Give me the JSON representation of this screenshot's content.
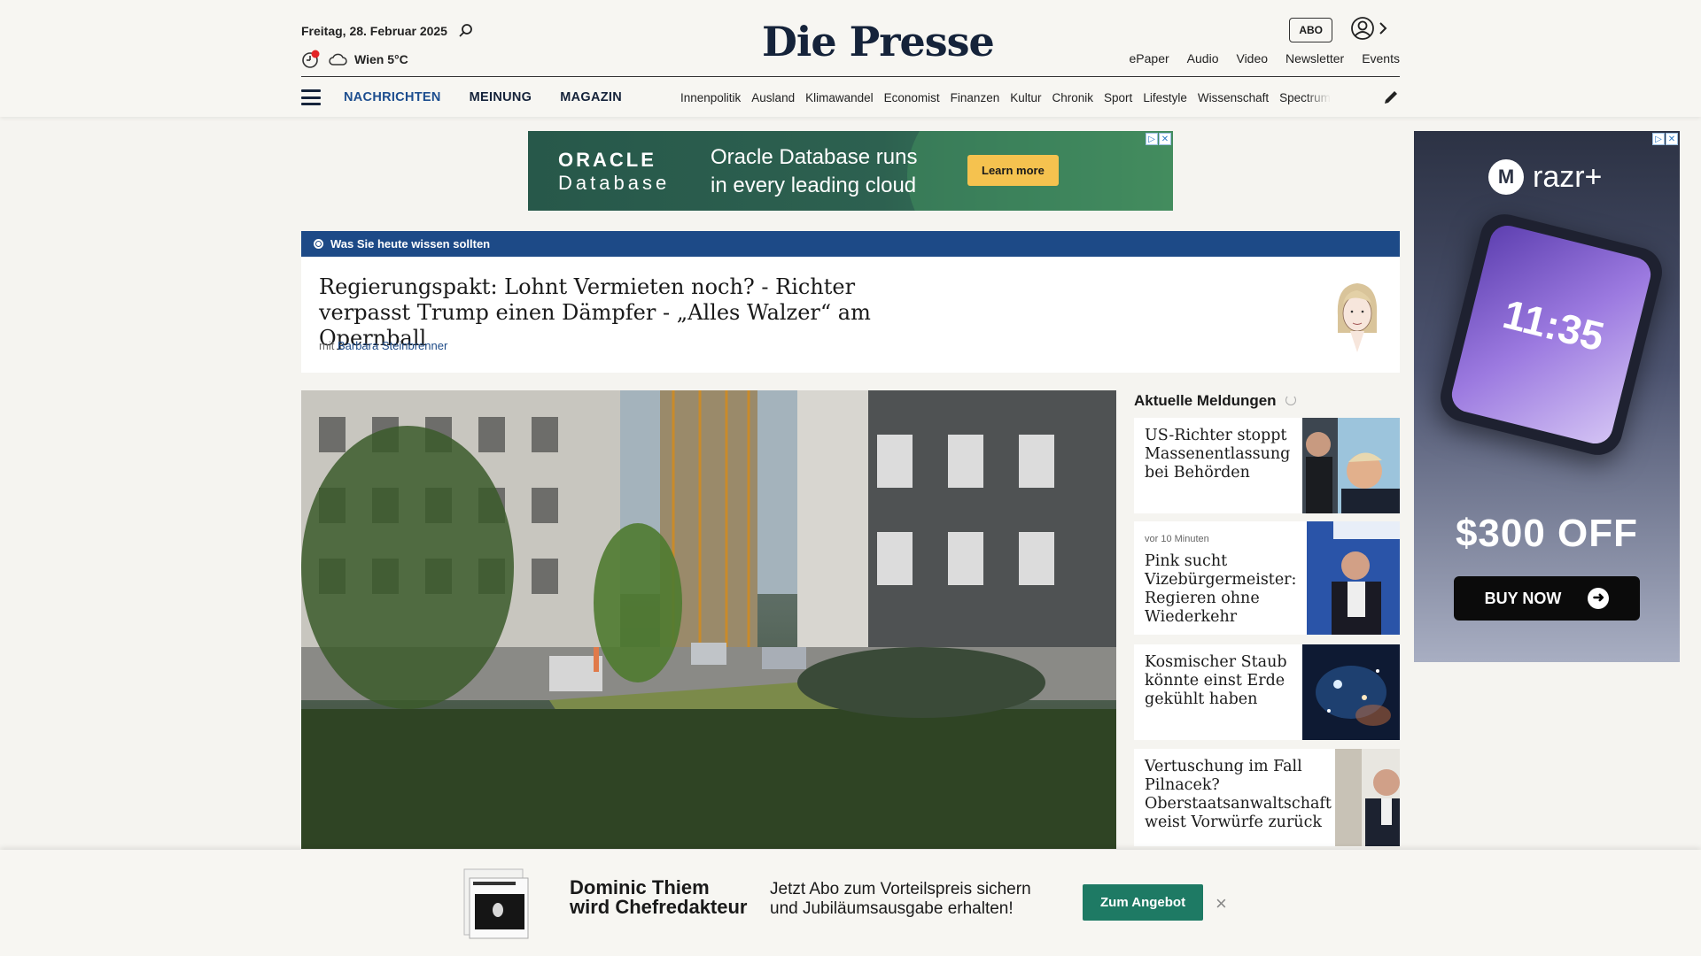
{
  "header": {
    "date": "Freitag, 28. Februar 2025",
    "weather": "Wien 5°C",
    "logo": "Die Presse",
    "abo_label": "ABO",
    "top_links": [
      "ePaper",
      "Audio",
      "Video",
      "Newsletter",
      "Events"
    ],
    "main_nav": [
      "NACHRICHTEN",
      "MEINUNG",
      "MAGAZIN"
    ],
    "sub_nav": [
      "Innenpolitik",
      "Ausland",
      "Klimawandel",
      "Economist",
      "Finanzen",
      "Kultur",
      "Chronik",
      "Sport",
      "Lifestyle",
      "Wissenschaft",
      "Spectrum"
    ]
  },
  "ad_top": {
    "brand_line1": "ORACLE",
    "brand_line2": "Database",
    "copy_line1": "Oracle Database runs",
    "copy_line2": "in every leading cloud",
    "cta": "Learn more"
  },
  "ad_side": {
    "brand": "razr+",
    "moto_letter": "M",
    "phone_time": "11:35",
    "offer": "$300 OFF",
    "cta": "BUY NOW"
  },
  "briefing": {
    "label": "Was Sie heute wissen sollten",
    "title": "Regierungspakt: Lohnt Vermieten noch? - Richter verpasst Trump einen Dämpfer - „Alles Walzer“ am Opernball",
    "author_prefix": "mit",
    "author": "Barbara Steinbrenner"
  },
  "sidebar": {
    "title": "Aktuelle Meldungen",
    "items": [
      {
        "time": "",
        "headline": "US-Richter stoppt Massenentlassung bei Behörden"
      },
      {
        "time": "vor 10 Minuten",
        "headline": "Pink sucht Vizebürgermeister: Regieren ohne Wiederkehr"
      },
      {
        "time": "",
        "headline": "Kosmischer Staub könnte einst Erde gekühlt haben"
      },
      {
        "time": "",
        "headline": "Vertuschung im Fall Pilnacek? Oberstaatsanwaltschaft weist Vorwürfe zurück"
      }
    ]
  },
  "promo": {
    "headline_line1": "Dominic Thiem",
    "headline_line2": "wird Chefredakteur",
    "copy_line1": "Jetzt Abo zum Vorteilspreis sichern",
    "copy_line2": "und Jubiläumsausgabe erhalten!",
    "cta": "Zum Angebot",
    "close": "×"
  },
  "colors": {
    "brand_blue": "#1d4a87",
    "promo_green": "#1e7a64",
    "oracle_green": "#2d6150",
    "ad_cta_yellow": "#f5c24f"
  }
}
